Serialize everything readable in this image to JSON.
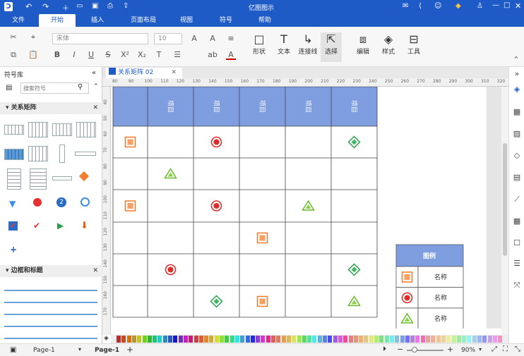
{
  "app": {
    "title": "亿图图示",
    "accent": "#1f5bc7"
  },
  "menu": {
    "items": [
      "文件",
      "开始",
      "插入",
      "页面布局",
      "视图",
      "符号",
      "帮助"
    ],
    "active": "开始"
  },
  "ribbon": {
    "font_name": "宋体",
    "font_size": "10",
    "big_buttons": [
      "形状",
      "文本",
      "连接线",
      "选择",
      "编辑",
      "样式",
      "工具"
    ]
  },
  "library": {
    "title": "符号库",
    "search_placeholder": "搜索符号",
    "section1": "关系矩阵",
    "section2": "边框和标题"
  },
  "tab": {
    "label": "关系矩阵 02"
  },
  "ruler": {
    "top": [
      "80",
      "90",
      "100",
      "110",
      "120",
      "130",
      "140",
      "150",
      "160",
      "170",
      "180",
      "190",
      "200",
      "210",
      "220",
      "230",
      "240",
      "250",
      "260",
      "270",
      "280",
      "290",
      "300",
      "310",
      "320"
    ],
    "left": [
      "40",
      "50",
      "60",
      "70",
      "80",
      "90",
      "100",
      "110",
      "120",
      "130",
      "140",
      "150",
      "160",
      "170"
    ]
  },
  "matrix": {
    "header": [
      "项目",
      "项目",
      "项目",
      "项目",
      "项目",
      "项目"
    ],
    "header_color": "#7f9ee0",
    "rows": [
      [
        "square",
        "",
        "circle",
        "",
        "",
        "diamond"
      ],
      [
        "",
        "triangle",
        "",
        "",
        "",
        ""
      ],
      [
        "square",
        "",
        "circle",
        "",
        "triangle",
        ""
      ],
      [
        "",
        "",
        "",
        "square",
        "",
        ""
      ],
      [
        "",
        "circle",
        "",
        "",
        "",
        "diamond"
      ],
      [
        "",
        "",
        "diamond",
        "square",
        "",
        "triangle"
      ]
    ]
  },
  "legend": {
    "title": "图例",
    "items": [
      {
        "symbol": "square",
        "label": "名称"
      },
      {
        "symbol": "circle",
        "label": "名称"
      },
      {
        "symbol": "triangle",
        "label": "名称"
      }
    ]
  },
  "status": {
    "page_selector": "Page-1",
    "page_tab": "Page-1",
    "add": "+",
    "zoom": "90%"
  }
}
